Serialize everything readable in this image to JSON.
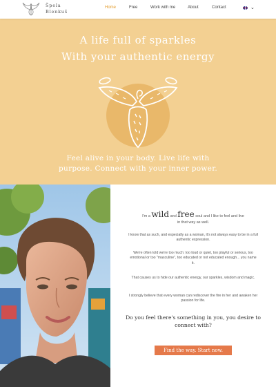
{
  "brand": {
    "line1": "Špela",
    "line2": "Blenkuš",
    "logo_icon": "butterfly-emblem-icon"
  },
  "nav": {
    "items": [
      {
        "label": "Home",
        "active": true
      },
      {
        "label": "Free",
        "active": false
      },
      {
        "label": "Work with me",
        "active": false
      },
      {
        "label": "About",
        "active": false
      },
      {
        "label": "Contact",
        "active": false
      }
    ],
    "language_icon": "uk-flag-icon"
  },
  "hero": {
    "title_line1": "A life full of sparkles",
    "title_line2": "With your authentic energy",
    "subtitle_line1": "Feel alive in your body. Live life with",
    "subtitle_line2": "purpose. Connect with your inner power.",
    "emblem_icon": "butterfly-emblem-icon"
  },
  "content": {
    "intro_pre": "I'm a",
    "intro_wild": "wild",
    "intro_and": "and",
    "intro_free": "free",
    "intro_post": "soul and I like to feel and live",
    "intro_line2": "in that way as well.",
    "p1": "I know that as such, and especially as a woman, it's not always easy to be in a full authentic expression.",
    "p2": "We're often told we're too much: too loud or quiet, too playful or serious, too emotional or too \"masculine\", too educated or not educated enough... you name it.",
    "p3": "That causes us to hide our authentic energy, our sparkles, wisdom and magic.",
    "p4": "I strongly believe that every woman can rediscover the fire in her and awaken her passion for life.",
    "question": "Do you feel there's something in you, you desire to connect with?",
    "cta_label": "Find the way. Start now."
  },
  "colors": {
    "hero_bg": "#f3d092",
    "accent": "#e39c2c",
    "cta_bg": "#e5794a"
  }
}
